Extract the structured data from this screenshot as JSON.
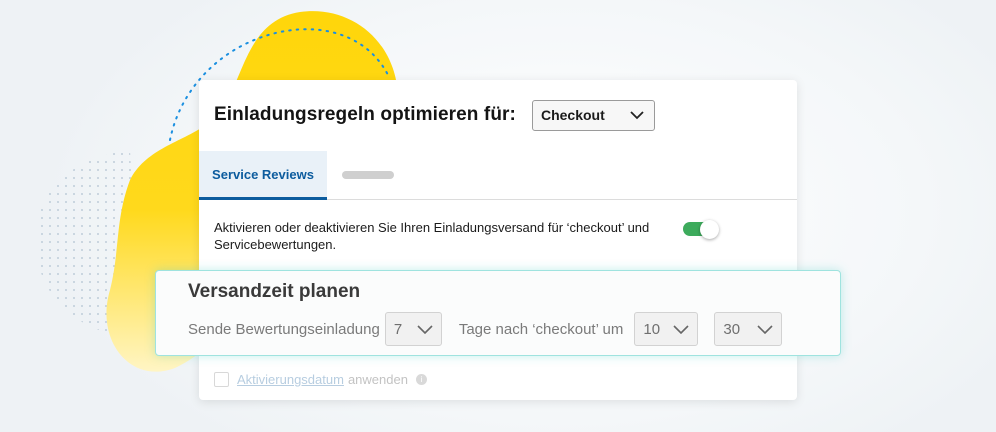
{
  "header": {
    "title": "Einladungsregeln optimieren für:",
    "select_value": "Checkout"
  },
  "tabs": [
    {
      "label": "Service Reviews",
      "active": true
    }
  ],
  "description": "Aktivieren oder deaktivieren Sie Ihren Einladungsversand für ‘checkout’ und Servicebewertungen.",
  "toggle": {
    "on": true
  },
  "schedule": {
    "title": "Versandzeit planen",
    "prefix_text": "Sende Bewertungseinladung",
    "days_value": "7",
    "middle_text": "Tage nach ‘checkout’ um",
    "hour_value": "10",
    "minute_value": "30"
  },
  "activation": {
    "link_text": "Aktivierungsdatum",
    "suffix_text": "anwenden"
  },
  "colors": {
    "brand_blue": "#0c5c9e",
    "toggle_green": "#3dab5c",
    "accent_yellow": "#ffd60a",
    "highlight_teal": "#9fe3df"
  }
}
